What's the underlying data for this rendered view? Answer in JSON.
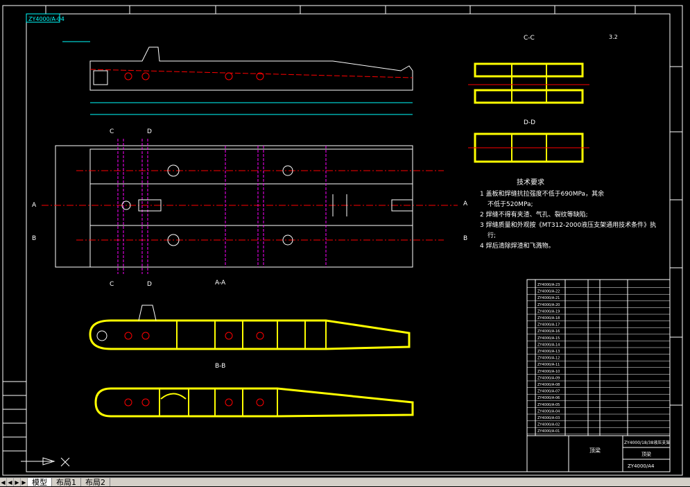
{
  "cad": {
    "stamp_top_left": "ZY4000/A-04",
    "section_cc": "C-C",
    "section_dd": "D-D",
    "section_aa": "A-A",
    "section_bb": "B-B",
    "label_a": "A",
    "label_b": "B",
    "label_c": "C",
    "label_d": "D",
    "surface_mark": "3.2",
    "tech_title": "技术要求",
    "tech_lines": [
      "1 盖板和焊缝抗拉强度不低于690MPa，其余",
      "不低于520MPa;",
      "2 焊缝不得有夹渣、气孔、裂纹等缺陷;",
      "3 焊缝质量和外观按《MT312-2000液压支架通用技术条件》执",
      "行;",
      "4 焊后清除焊渣和飞溅物。"
    ],
    "bom_rows": [
      "ZY4000/A-23",
      "ZY4000/A-22",
      "ZY4000/A-21",
      "ZY4000/A-20",
      "ZY4000/A-19",
      "ZY4000/A-18",
      "ZY4000/A-17",
      "ZY4000/A-16",
      "ZY4000/A-15",
      "ZY4000/A-14",
      "ZY4000/A-13",
      "ZY4000/A-12",
      "ZY4000/A-11",
      "ZY4000/A-10",
      "ZY4000/A-09",
      "ZY4000/A-08",
      "ZY4000/A-07",
      "ZY4000/A-06",
      "ZY4000/A-05",
      "ZY4000/A-04",
      "ZY4000/A-03",
      "ZY4000/A-02",
      "ZY4000/A-01"
    ],
    "title_block": {
      "name": "顶梁",
      "company": "ZY4000/18/38液压支架",
      "drawing_no": "ZY4000/A4",
      "material": "顶梁"
    }
  },
  "tabs": [
    {
      "label": "模型",
      "active": true
    },
    {
      "label": "布局1",
      "active": false
    },
    {
      "label": "布局2",
      "active": false
    }
  ],
  "nav": {
    "first": "◀",
    "prev": "◀",
    "next": "▶",
    "last": "▶"
  },
  "colors": {
    "background": "#000000",
    "cyan": "#00ffff",
    "yellow": "#ffff00",
    "magenta": "#ff00ff",
    "red": "#ff0000",
    "white": "#ffffff"
  }
}
